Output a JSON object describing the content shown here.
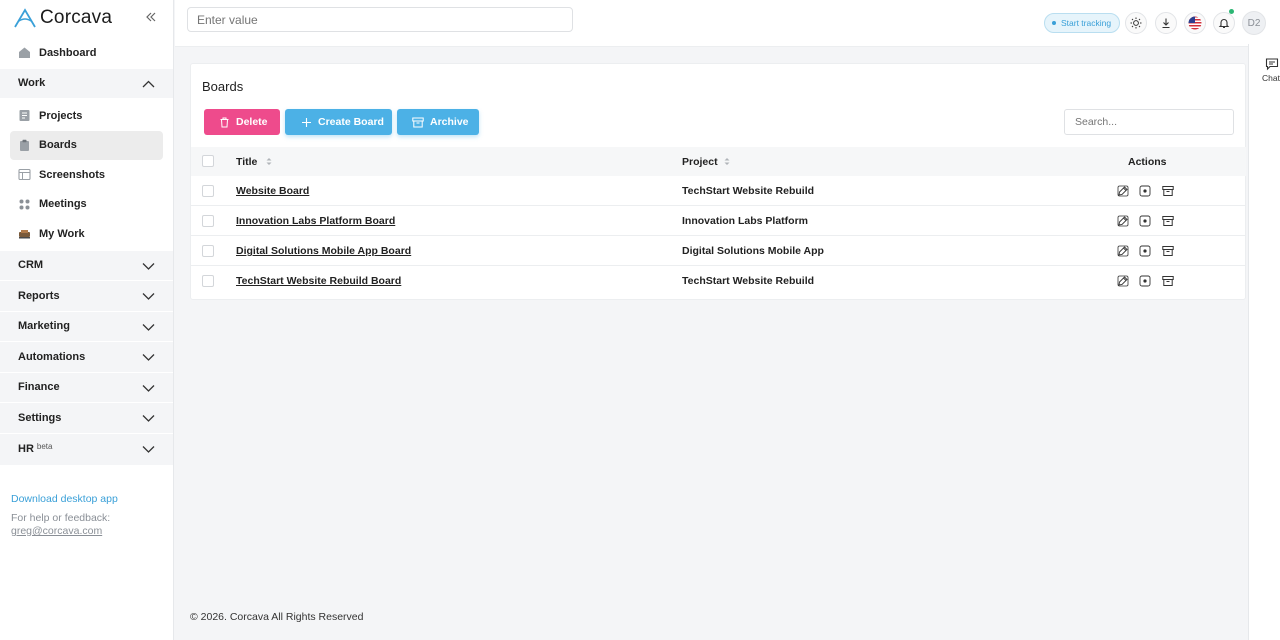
{
  "app": {
    "name": "Corcava"
  },
  "topbar": {
    "search_placeholder": "Enter value",
    "tracking_label": "Start tracking",
    "avatar_initials": "D2"
  },
  "sidebar": {
    "dashboard": "Dashboard",
    "work": "Work",
    "work_items": [
      "Projects",
      "Boards",
      "Screenshots",
      "Meetings",
      "My Work"
    ],
    "groups": [
      "CRM",
      "Reports",
      "Marketing",
      "Automations",
      "Finance",
      "Settings",
      "HR"
    ],
    "hr_badge": "beta",
    "download_app": "Download desktop app",
    "help_text": "For help or feedback:",
    "help_email": "greg@corcava.com"
  },
  "chat": {
    "label": "Chat"
  },
  "boards": {
    "title": "Boards",
    "buttons": {
      "delete": "Delete",
      "create": "Create Board",
      "archive": "Archive"
    },
    "search_placeholder": "Search...",
    "columns": {
      "title": "Title",
      "project": "Project",
      "actions": "Actions"
    },
    "rows": [
      {
        "title": "Website Board",
        "project": "TechStart Website Rebuild"
      },
      {
        "title": "Innovation Labs Platform Board",
        "project": "Innovation Labs Platform"
      },
      {
        "title": "Digital Solutions Mobile App Board",
        "project": "Digital Solutions Mobile App"
      },
      {
        "title": "TechStart Website Rebuild Board",
        "project": "TechStart Website Rebuild"
      }
    ]
  },
  "footer": {
    "copyright": "© 2026. Corcava All Rights Reserved"
  },
  "colors": {
    "accent": "#4cb1e6",
    "danger": "#ee4b8c"
  }
}
